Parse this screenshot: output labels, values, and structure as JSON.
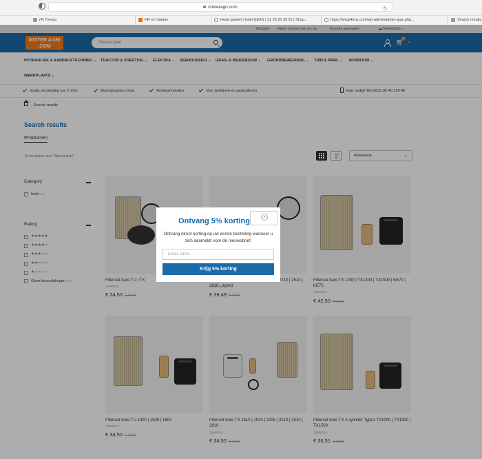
{
  "browser": {
    "url": "misteragri.com",
    "tabs": [
      {
        "label": "(4) Trengo"
      },
      {
        "label": "HR en Salaris"
      },
      {
        "label": "Head gasket | Iseki GEAS | 31 23 20 29 33 | Shop..."
      },
      {
        "label": "https://shop4trac.com/wp-admin/admin-ajax.php..."
      },
      {
        "label": "Search results"
      }
    ]
  },
  "topbar": {
    "login": "Inloggen",
    "contact": "Neem contact met ons op",
    "register": "Account aanmaken",
    "country": "Nederlands"
  },
  "header": {
    "logo_line1": "MISTER AGRI",
    "logo_line2": ".COM",
    "search_value": "filterset iseki",
    "cart_count": "0"
  },
  "nav": {
    "items": [
      "HYDRAULIEK & AANDRIJFTECHNIEK",
      "TRACTOR & VOERTUIG",
      "ELEKTRA",
      "VEEHOUDERIJ",
      "GRAS- & WEIDEBOUW",
      "GRONDBEWERKING",
      "TUIN & PARK",
      "BOSBOUW",
      "WERKPLAATS"
    ]
  },
  "usps": {
    "items": [
      "Gratis verzending v.a. € 150,-",
      "Bezorging bij u thuis",
      "Achteraf betalen",
      "Voor bedrijven en particulieren"
    ],
    "help": "Hulp nodig? Bel 0031 85 40 139 40"
  },
  "breadcrumb": {
    "current": "Search results"
  },
  "page": {
    "title": "Search results",
    "subtab": "Producten",
    "result_count": "13 resultaten voor \"filterset iseki\"",
    "sort": "Relevantie"
  },
  "filters": {
    "category_title": "Category",
    "category_option": "Iseki",
    "category_count": "(13)",
    "rating_title": "Rating",
    "rating_options": [
      {
        "filled": "★★★★★",
        "empty": ""
      },
      {
        "filled": "★★★★",
        "empty": "★"
      },
      {
        "filled": "★★★",
        "empty": "★★"
      },
      {
        "filled": "★★",
        "empty": "★★★"
      },
      {
        "filled": "★",
        "empty": "★★★★"
      }
    ],
    "no_reviews": "Geen beoordelingen",
    "no_reviews_count": "(13)"
  },
  "products": [
    {
      "name": "Filterset Iseki TU | TX",
      "sku": "10000013",
      "price": "€ 24,50",
      "old_price": "€ 29,40"
    },
    {
      "name": "Filterset Iseki TS 1610 | 1910 | 2205 | 2210 | 2510 | 2810 ...type1",
      "sku": "10000015",
      "price": "€ 39,49",
      "old_price": "€ 47,39"
    },
    {
      "name": "Filterset Iseki TX 1000 | TX1300 | TX1500 | KE70 | KE75",
      "sku": "10000014",
      "price": "€ 42,50",
      "old_price": "€ 51,00"
    },
    {
      "name": "Filterset Iseki TU 1400 | 1500 | 1600",
      "sku": "10000012",
      "price": "€ 34,50",
      "old_price": "€ 41,39"
    },
    {
      "name": "Filterset Iseki TS 1610 | 1910 | 2205 | 2210 | 2510 | 2810",
      "sku": "10000016",
      "price": "€ 34,50",
      "old_price": "€ 41,39"
    },
    {
      "name": "Filterset Iseki TX 2 cylinder Type1 TX1000 | TX1300 | TX1500",
      "sku": "10000016",
      "price": "€ 36,51",
      "old_price": "€ 43,80"
    }
  ],
  "modal": {
    "title": "Ontvang 5% korting",
    "text": "Ontvang direct korting op uw eerste bestelling wanneer u zich aanmeldt voor de nieuwsbrief.",
    "email_placeholder": "Email adres",
    "button": "Krijg 5% korting"
  }
}
